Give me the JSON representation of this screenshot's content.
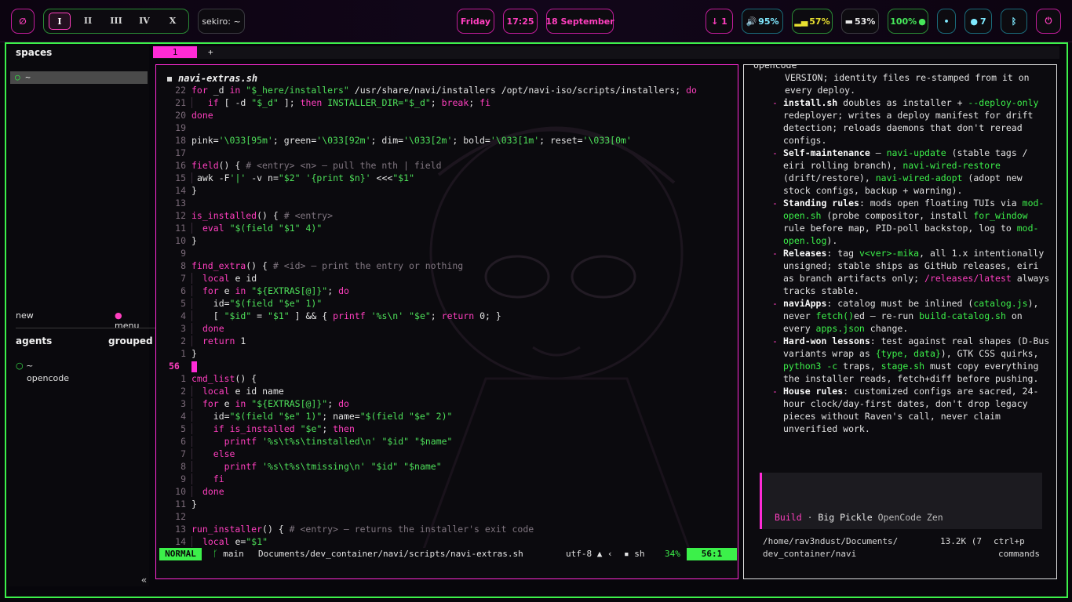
{
  "topbar": {
    "launcher_icon": "null-circle-icon",
    "workspaces": [
      "I",
      "II",
      "III",
      "IV",
      "X"
    ],
    "active_workspace": "I",
    "host": "sekiro: ~",
    "day": "Friday",
    "time": "17:25",
    "date": "18 September",
    "download": "↓ 1",
    "volume": "95%",
    "wifi": "57%",
    "brightness": "53%",
    "battery": "100%",
    "dot_icon": "dot-icon",
    "updates": "7",
    "bluetooth_icon": "bluetooth-icon",
    "power_icon": "power-icon"
  },
  "sidebar": {
    "spaces_title": "spaces",
    "space_item": "~",
    "new_label": "new",
    "menu_label": "menu",
    "agents_title": "agents",
    "grouped_label": "grouped",
    "agent_dir": "~",
    "agent_name": "opencode",
    "collapse": "«"
  },
  "tabs": {
    "tab1": "1",
    "add": "+"
  },
  "editor": {
    "filename": "navi-extras.sh",
    "mode": "NORMAL",
    "branch": "main",
    "path": "Documents/dev_container/navi/scripts/navi-extras.sh",
    "encoding": "utf-8",
    "filetype": "sh",
    "percent": "34%",
    "position": "56:1",
    "current_line": "56"
  },
  "opencode": {
    "title": "opencode",
    "build_label": "Build",
    "model": "Big Pickle",
    "provider": "OpenCode Zen",
    "cwd_line1": "/home/rav3ndust/Documents/",
    "cwd_line2": "dev_container/navi",
    "tokens": "13.2K (7",
    "keybind_line1": "ctrl+p",
    "keybind_line2": "commands"
  },
  "colors": {
    "accent_pink": "#ff2bd6",
    "accent_green": "#3cf04a"
  }
}
